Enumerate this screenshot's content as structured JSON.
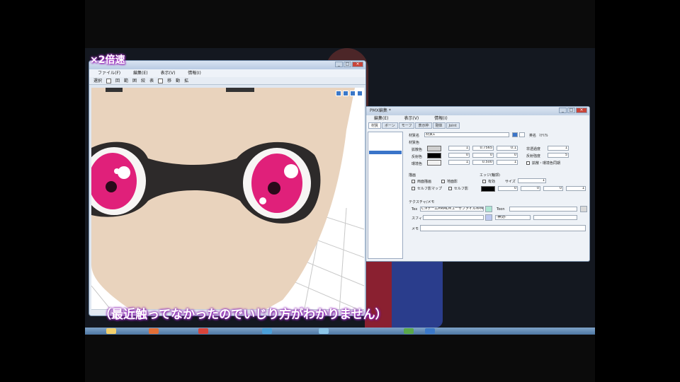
{
  "overlay": {
    "speed_label": "×2倍速",
    "subtitle": "（最近触ってなかったのでいじり方がわかりません）"
  },
  "pmd_window": {
    "menu": [
      "ファイル(F)",
      "編集(E)",
      "表示(V)",
      "情報(I)"
    ],
    "toolbar": [
      "選択",
      "回",
      "範",
      "囲",
      "絞",
      "表",
      "移",
      "動",
      "拡"
    ],
    "window_buttons": [
      "_",
      "□",
      "×"
    ]
  },
  "material_window": {
    "title": "PMX編集 *",
    "menu": [
      "編集(E)",
      "表示(V)",
      "情報(I)"
    ],
    "tabs": [
      "材質",
      "ボーン",
      "モーフ",
      "表示枠",
      "剛体",
      "Joint"
    ],
    "name_label": "材質名",
    "name_value": "材質1",
    "english_label": "英名",
    "english_value": "ﾏﾃﾘｱﾙ",
    "color_section": "材質色",
    "diffuse_label": "拡散色",
    "specular_label": "反射色",
    "ambient_label": "環境色",
    "diffuse_values": [
      "1",
      "0.7565",
      "0.1"
    ],
    "specular_values": [
      "0",
      "0",
      "0"
    ],
    "ambient_values": [
      "1",
      "0.500",
      "1"
    ],
    "alpha_label": "非透過度",
    "alpha_value": "1",
    "power_label": "反射強度",
    "power_value": "5",
    "share_label": "拡散・環境色同期",
    "draw_section": "描画",
    "double_sided": "両面描画",
    "ground_shadow": "地面影",
    "self_shadow_map": "セルフ影マップ",
    "self_shadow": "セルフ影",
    "edge_section": "エッジ(輪郭)",
    "edge_enable": "有効",
    "edge_size_label": "サイズ",
    "edge_size_value": "1",
    "edge_values": [
      "0",
      "0",
      "0",
      "1"
    ],
    "texture_section": "テクスチャ/メモ",
    "tex_label": "Tex",
    "tex_value": "C:¥ゲーム¥MMD¥ユーザファイル¥PMX¥モデル¥Model¥...",
    "toon_label": "Toon",
    "sphere_label": "スフィア",
    "sphere_mode": "-無効-",
    "memo_label": "メモ",
    "window_buttons": [
      "_",
      "□",
      "×"
    ]
  },
  "colors": {
    "skin": "#e9d3bd",
    "iris": "#e0207a",
    "goggle": "#2a2a2a",
    "accent_glow": "#b23bd0"
  }
}
